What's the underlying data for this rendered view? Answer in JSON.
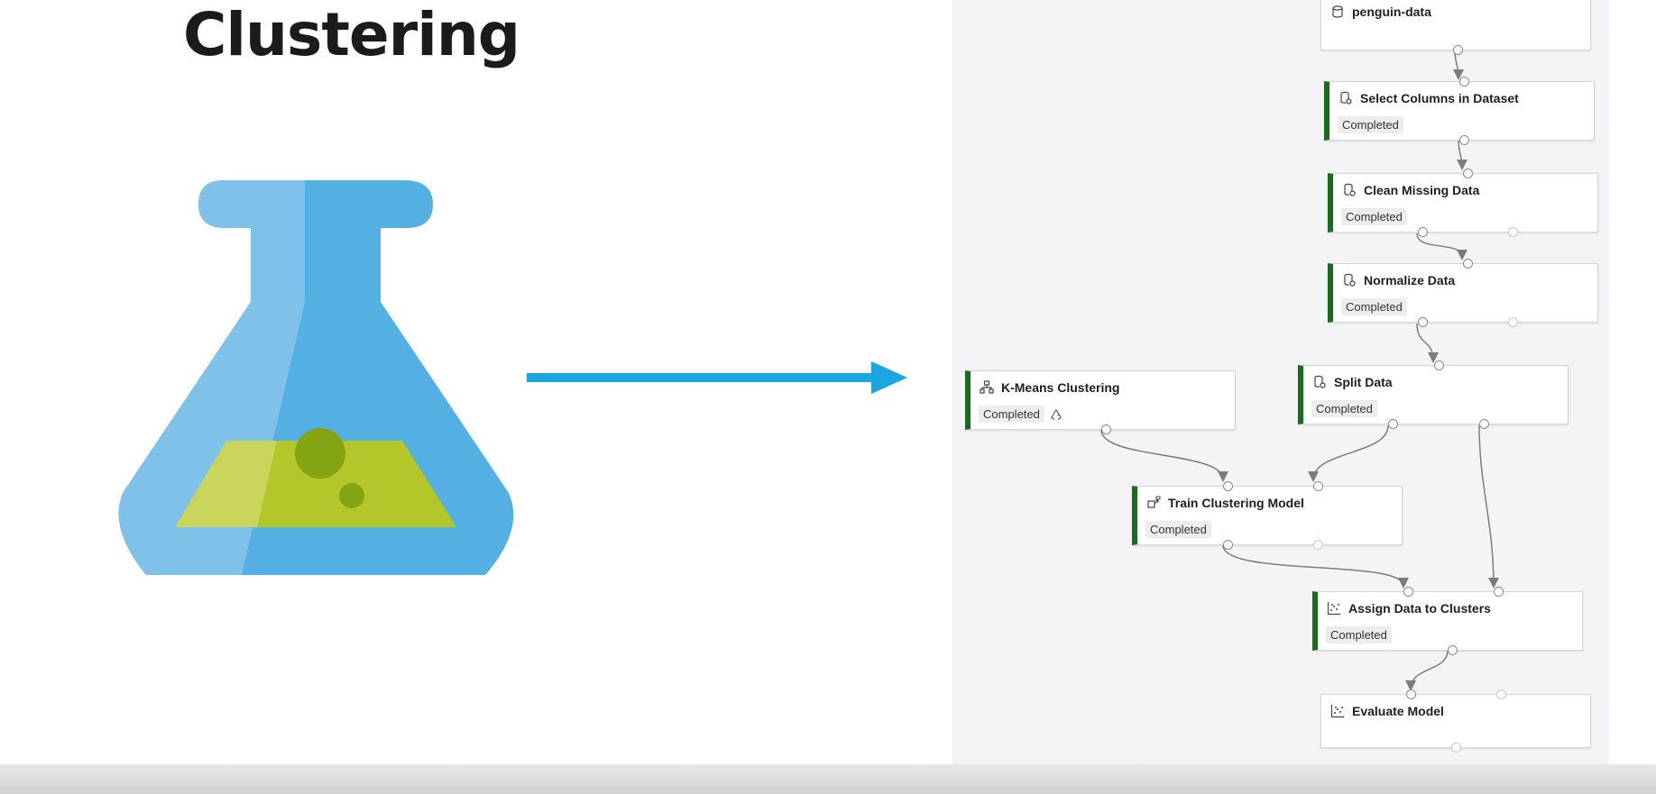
{
  "slide": {
    "title": "Clustering"
  },
  "illustration": {
    "flask": {
      "body_left": "#80c1e9",
      "body_right": "#54afe2",
      "liquid_left": "#c9d65b",
      "liquid_right": "#b3c72b",
      "bubbles": "#84a411"
    },
    "arrow": {
      "color": "#1ba6e0"
    }
  },
  "pipeline": {
    "nodes": [
      {
        "id": "penguin",
        "title": "penguin-data",
        "icon": "dataset-icon",
        "status": ""
      },
      {
        "id": "select",
        "title": "Select Columns in Dataset",
        "icon": "data-transform-icon",
        "status": "Completed"
      },
      {
        "id": "clean",
        "title": "Clean Missing Data",
        "icon": "data-transform-icon",
        "status": "Completed"
      },
      {
        "id": "normalize",
        "title": "Normalize Data",
        "icon": "data-transform-icon",
        "status": "Completed"
      },
      {
        "id": "split",
        "title": "Split Data",
        "icon": "data-transform-icon",
        "status": "Completed"
      },
      {
        "id": "kmeans",
        "title": "K-Means Clustering",
        "icon": "model-tree-icon",
        "status": "Completed",
        "reused": true
      },
      {
        "id": "train",
        "title": "Train Clustering Model",
        "icon": "train-model-icon",
        "status": "Completed"
      },
      {
        "id": "assign",
        "title": "Assign Data to Clusters",
        "icon": "scatter-chart-icon",
        "status": "Completed"
      },
      {
        "id": "evaluate",
        "title": "Evaluate Model",
        "icon": "scatter-chart-icon",
        "status": ""
      }
    ],
    "colors": {
      "completed_bar": "#1b6b1f",
      "canvas": "#f4f4f6",
      "edge": "#7c7c7c"
    }
  }
}
